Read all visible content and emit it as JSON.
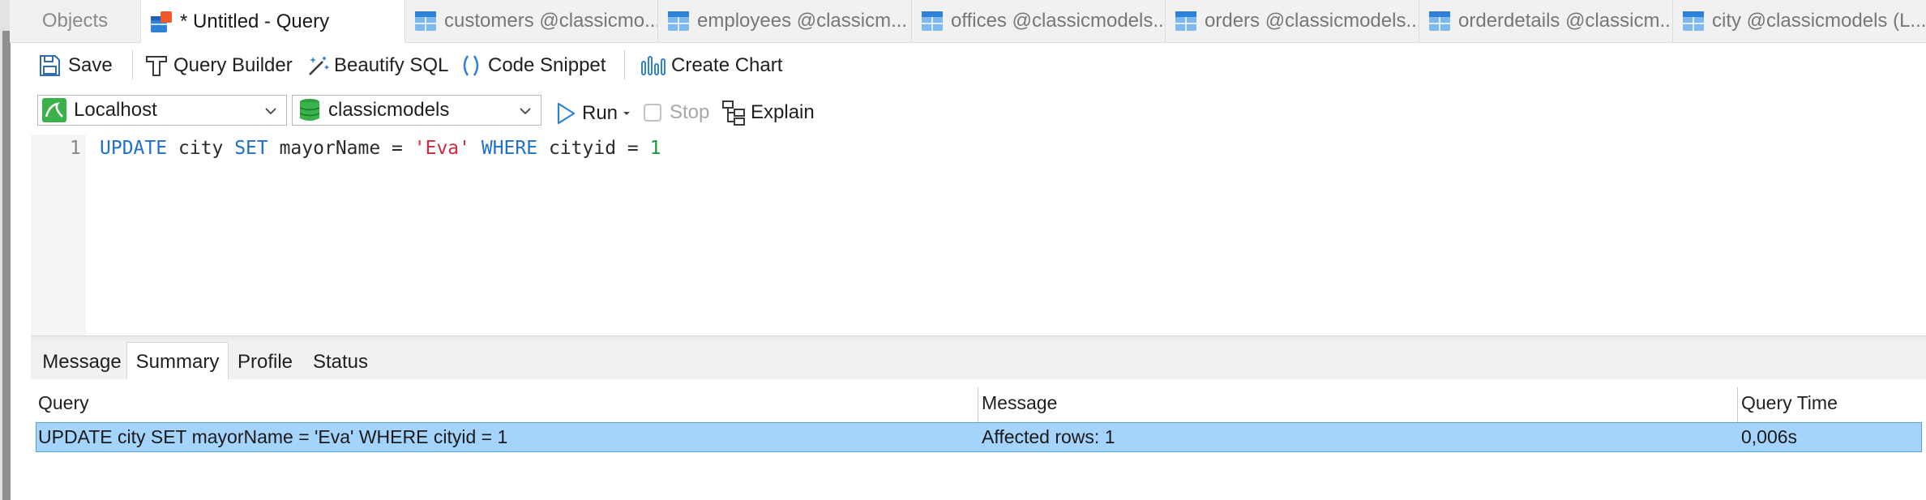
{
  "tabs": [
    {
      "label": "Objects",
      "icon": "none"
    },
    {
      "label": "* Untitled - Query",
      "icon": "query-icon"
    },
    {
      "label": "customers @classicmo...",
      "icon": "table-icon"
    },
    {
      "label": "employees @classicm...",
      "icon": "table-icon"
    },
    {
      "label": "offices @classicmodels...",
      "icon": "table-icon"
    },
    {
      "label": "orders @classicmodels...",
      "icon": "table-icon"
    },
    {
      "label": "orderdetails @classicm...",
      "icon": "table-icon"
    },
    {
      "label": "city @classicmodels (L...",
      "icon": "table-icon"
    }
  ],
  "toolbar": {
    "save": "Save",
    "query_builder": "Query Builder",
    "beautify": "Beautify SQL",
    "code_snippet": "Code Snippet",
    "create_chart": "Create Chart"
  },
  "connection": {
    "host": "Localhost",
    "database": "classicmodels",
    "run": "Run",
    "stop": "Stop",
    "explain": "Explain"
  },
  "editor": {
    "line_number": "1",
    "tokens": {
      "update": "UPDATE",
      "table": " city ",
      "set": "SET",
      "col": " mayorName = ",
      "value": "'Eva'",
      "sp": " ",
      "where": "WHERE",
      "cond": " cityid = ",
      "num": "1"
    }
  },
  "result_tabs": [
    "Message",
    "Summary",
    "Profile",
    "Status"
  ],
  "active_result_tab": "Summary",
  "summary": {
    "headers": [
      "Query",
      "Message",
      "Query Time"
    ],
    "rows": [
      [
        "UPDATE city SET mayorName = 'Eva' WHERE cityid = 1",
        "Affected rows: 1",
        "0,006s"
      ]
    ]
  },
  "colors": {
    "accent": "#1f6fd1",
    "selection": "#a4d4fb",
    "string": "#d1293d",
    "number": "#1a9a3a"
  }
}
